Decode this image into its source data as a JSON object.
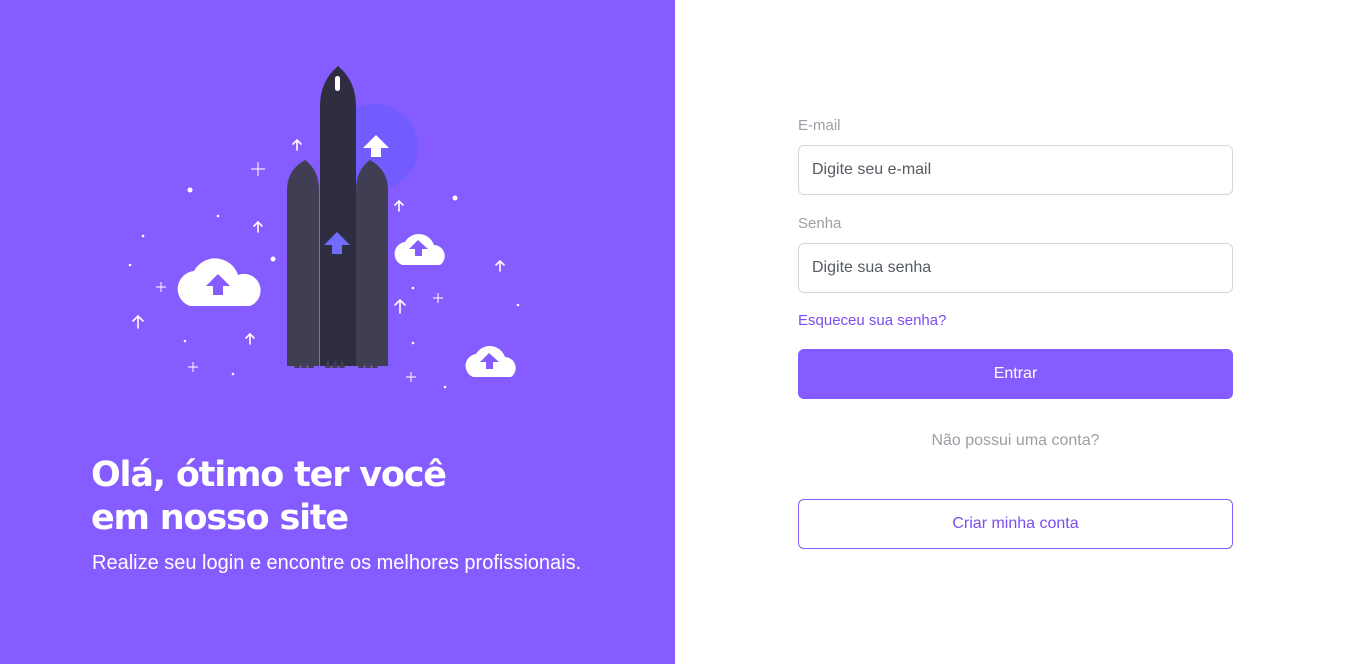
{
  "hero": {
    "headline_line1": "Olá, ótimo ter você",
    "headline_line2": "em nosso site",
    "subtitle": "Realize seu login e encontre os melhores profissionais.",
    "illustration": "rocket-launch-illustration"
  },
  "form": {
    "email_label": "E-mail",
    "email_placeholder": "Digite seu e-mail",
    "password_label": "Senha",
    "password_placeholder": "Digite sua senha",
    "forgot_link": "Esqueceu sua senha?",
    "submit_label": "Entrar",
    "no_account_text": "Não possui uma conta?",
    "create_account_label": "Criar minha conta"
  },
  "colors": {
    "brand": "#855cff",
    "link": "#7a4df0",
    "muted": "#9aa0a6",
    "rocket": "#3b3a4d"
  }
}
